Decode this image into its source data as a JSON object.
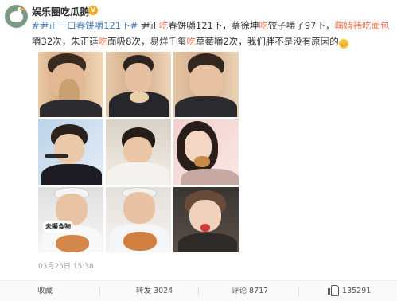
{
  "post": {
    "author": "娱乐圈吃瓜鹅",
    "verified_badge": "V",
    "text_segments": [
      {
        "t": "#尹正一口春饼嚼121下#",
        "c": "topic"
      },
      {
        "t": " 尹正",
        "c": ""
      },
      {
        "t": "吃",
        "c": "hl"
      },
      {
        "t": "春饼嚼121下，蔡徐坤",
        "c": ""
      },
      {
        "t": "吃",
        "c": "hl"
      },
      {
        "t": "饺子嚼了97下，",
        "c": ""
      },
      {
        "t": "鞠婧祎吃面包",
        "c": "hl"
      },
      {
        "t": "嚼32次，朱正廷",
        "c": ""
      },
      {
        "t": "吃",
        "c": "hl"
      },
      {
        "t": "面吸8次，易烊千玺",
        "c": ""
      },
      {
        "t": "吃",
        "c": "hl"
      },
      {
        "t": "草莓嚼2次，我们胖不是没有原因的",
        "c": ""
      }
    ],
    "emoji_icon": "laughing-face-emoji",
    "photo_overlay_label": "未嚼食物",
    "timestamp": "03月25日 15:38"
  },
  "actions": {
    "collect_label": "收藏",
    "repost_label": "转发 3024",
    "comment_label": "评论 8717",
    "like_label": "135291"
  },
  "colors": {
    "highlight": "#eb7350",
    "topic": "#4a7ab8",
    "badge": "#f5a623"
  }
}
